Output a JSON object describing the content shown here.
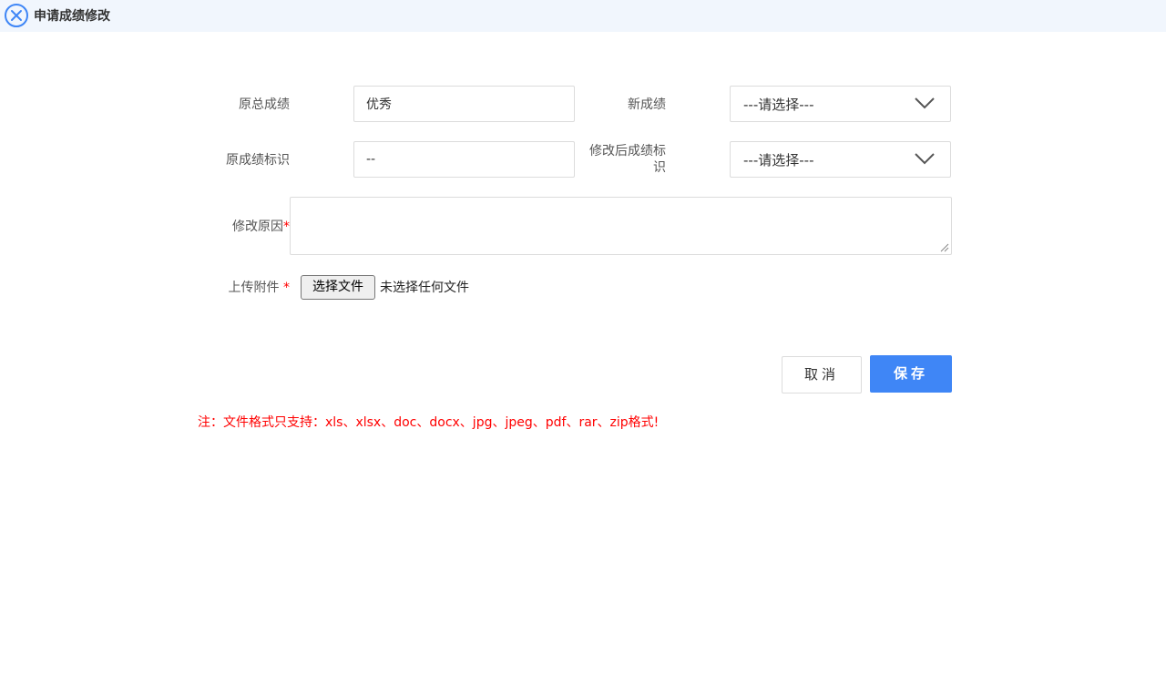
{
  "window": {
    "title": "申请成绩修改",
    "close_icon": "circle-x-icon"
  },
  "form": {
    "original_total_label": "原总成绩",
    "original_total_value": "优秀",
    "new_grade_label": "新成绩",
    "new_grade_value": "---请选择---",
    "original_flag_label": "原成绩标识",
    "original_flag_value": "--",
    "modified_flag_label_line1": "修改后成绩标",
    "modified_flag_label_line2": "识",
    "modified_flag_value": "---请选择---",
    "reason_label": "修改原因",
    "reason_required": "*",
    "reason_value": "",
    "upload_label": "上传附件",
    "upload_required": "*",
    "file_button_label": "选择文件",
    "file_status": "未选择任何文件"
  },
  "actions": {
    "cancel_label": "取消",
    "save_label": "保存"
  },
  "note": "注：文件格式只支持：xls、xlsx、doc、docx、jpg、jpeg、pdf、rar、zip格式!",
  "colors": {
    "titlebar_bg": "#f1f6fd",
    "accent": "#3f86f6",
    "required": "#ff0000",
    "border": "#dcdcdc"
  }
}
